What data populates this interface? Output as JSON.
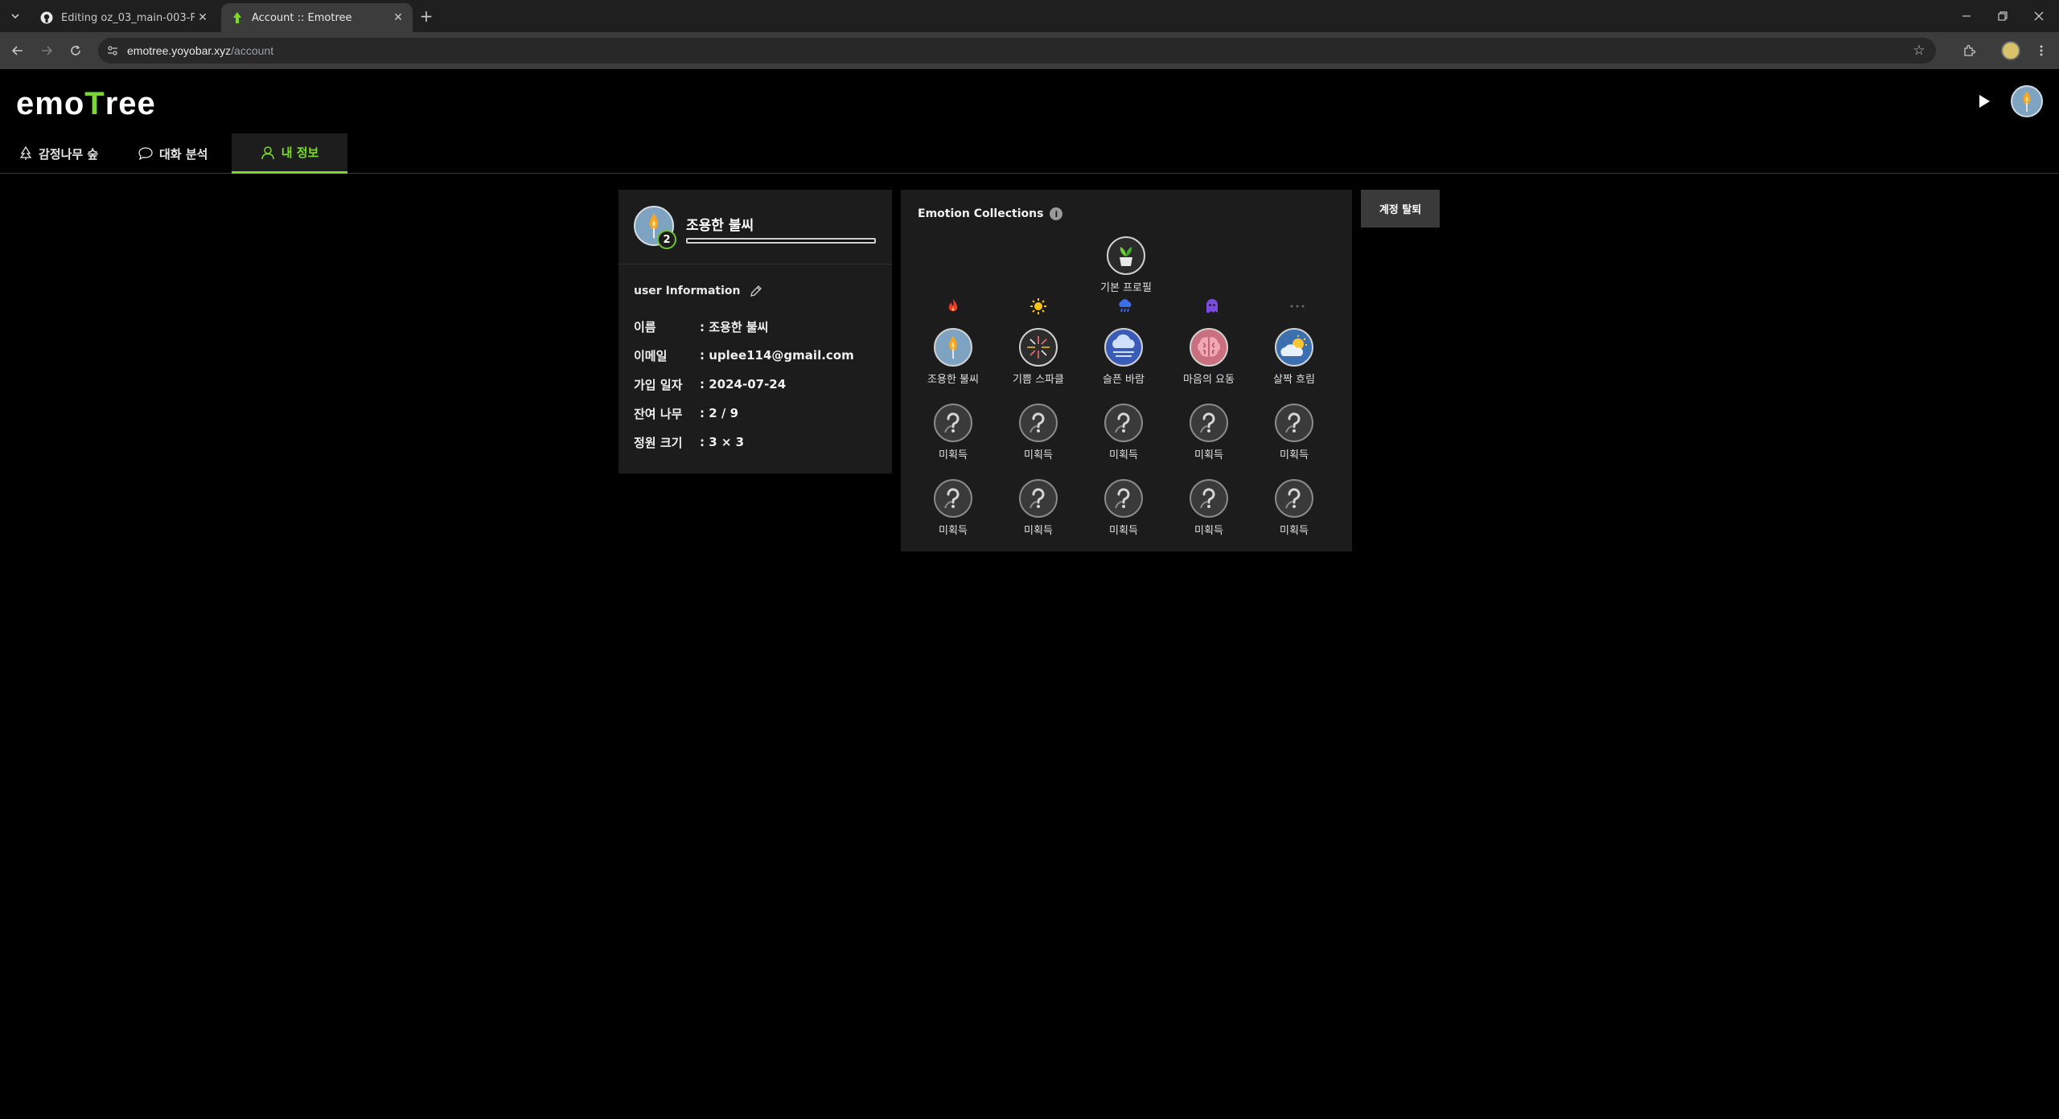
{
  "browser": {
    "tabs": [
      {
        "title": "Editing oz_03_main-003-FE/RE",
        "active": false,
        "icon": "github-icon"
      },
      {
        "title": "Account :: Emotree",
        "active": true,
        "icon": "emotree-favicon"
      }
    ],
    "url_host": "emotree.yoyobar.xyz",
    "url_path": "/account"
  },
  "app": {
    "logo_text_a": "emo",
    "logo_text_b": "T",
    "logo_text_c": "ree",
    "accent_color": "#7bdc22",
    "nav": [
      {
        "label": "감정나무 숲",
        "icon": "tree-icon"
      },
      {
        "label": "대화 분석",
        "icon": "chat-bubble-icon"
      },
      {
        "label": "내 정보",
        "icon": "user-icon"
      }
    ]
  },
  "profile": {
    "name": "조용한 불씨",
    "level": "2",
    "progress": 0.0,
    "info_title": "user Information",
    "rows": [
      {
        "key": "이름",
        "value": ": 조용한 불씨"
      },
      {
        "key": "이메일",
        "value": ": uplee114@gmail.com"
      },
      {
        "key": "가입 일자",
        "value": ": 2024-07-24"
      },
      {
        "key": "잔여 나무",
        "value": ": 2 / 9"
      },
      {
        "key": "정원 크기",
        "value": ": 3 × 3"
      }
    ]
  },
  "collection": {
    "title": "Emotion Collections",
    "default_item": {
      "label": "기본 프로필",
      "icon": "sprout-pot-icon"
    },
    "categories": [
      {
        "icon": "fire-icon",
        "color": "#e8392b"
      },
      {
        "icon": "sun-icon",
        "color": "#f5c518"
      },
      {
        "icon": "rain-cloud-icon",
        "color": "#3b6ee8"
      },
      {
        "icon": "ghost-icon",
        "color": "#7a4be0"
      },
      {
        "icon": "ellipsis-icon",
        "color": "#6a6a6a"
      }
    ],
    "unlocked": [
      {
        "label": "조용한 불씨",
        "icon": "candle-icon"
      },
      {
        "label": "기쁨 스파클",
        "icon": "sparkle-icon"
      },
      {
        "label": "슬픈 바람",
        "icon": "sad-cloud-icon"
      },
      {
        "label": "마음의 요동",
        "icon": "brain-icon"
      },
      {
        "label": "살짝 흐림",
        "icon": "partly-cloudy-icon"
      }
    ],
    "locked_label": "미획득",
    "locked_rows": 2
  },
  "withdraw_label": "계정 탈퇴"
}
